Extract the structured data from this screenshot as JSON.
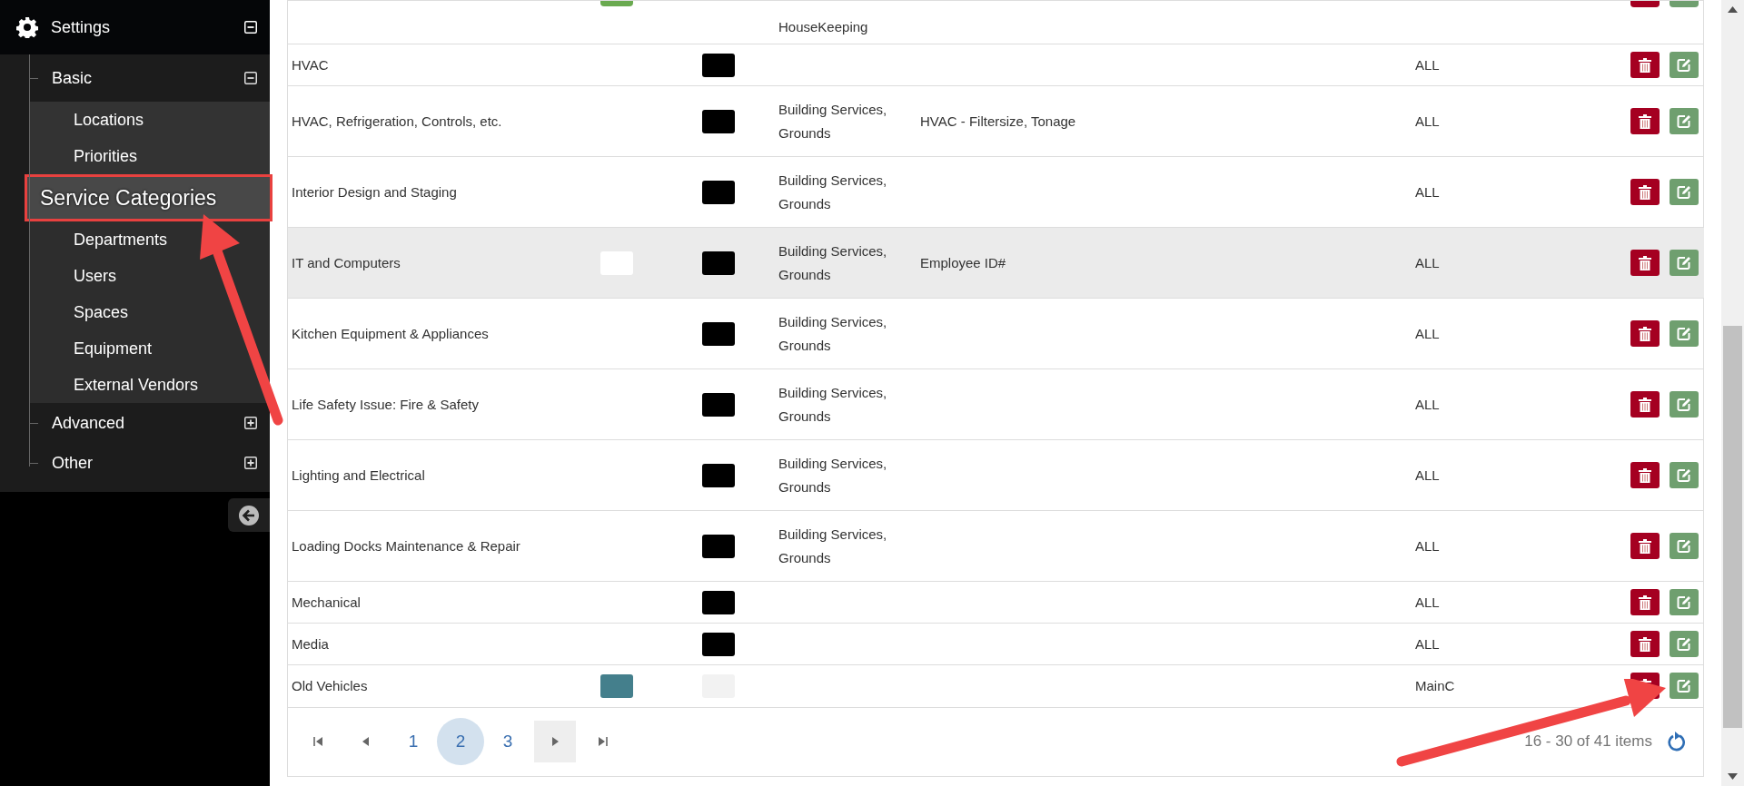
{
  "sidebar": {
    "title": "Settings",
    "expanded": true,
    "groups": [
      {
        "label": "Basic",
        "expanded": true,
        "children": [
          {
            "label": "Locations",
            "selected": false
          },
          {
            "label": "Priorities",
            "selected": false
          },
          {
            "label": "Service Categories",
            "selected": true
          },
          {
            "label": "Departments",
            "selected": false
          },
          {
            "label": "Users",
            "selected": false
          },
          {
            "label": "Spaces",
            "selected": false
          },
          {
            "label": "Equipment",
            "selected": false
          },
          {
            "label": "External Vendors",
            "selected": false
          }
        ]
      },
      {
        "label": "Advanced",
        "expanded": false
      },
      {
        "label": "Other",
        "expanded": false
      }
    ]
  },
  "table": {
    "rows": [
      {
        "kind": "clipped",
        "selected": false,
        "name": "",
        "swatch_1": {
          "color": "#6aaa50"
        },
        "departments": "HouseKeeping",
        "location": ""
      },
      {
        "kind": "full",
        "selected": false,
        "name": "HVAC",
        "swatch_2": {
          "color": "#000000"
        },
        "location": "ALL"
      },
      {
        "kind": "full",
        "selected": false,
        "name": "HVAC, Refrigeration, Controls, etc.",
        "swatch_2": {
          "color": "#000000"
        },
        "departments": "Building Services, Grounds",
        "fields": "HVAC - Filtersize, Tonage",
        "location": "ALL"
      },
      {
        "kind": "full",
        "selected": false,
        "name": "Interior Design and Staging",
        "swatch_2": {
          "color": "#000000"
        },
        "departments": "Building Services, Grounds",
        "location": "ALL"
      },
      {
        "kind": "full",
        "selected": true,
        "name": "IT and Computers",
        "swatch_1": {
          "color": "#ffffff"
        },
        "swatch_2": {
          "color": "#000000"
        },
        "departments": "Building Services, Grounds",
        "fields": "Employee ID#",
        "location": "ALL"
      },
      {
        "kind": "full",
        "selected": false,
        "name": "Kitchen Equipment & Appliances",
        "swatch_2": {
          "color": "#000000"
        },
        "departments": "Building Services, Grounds",
        "location": "ALL"
      },
      {
        "kind": "full",
        "selected": false,
        "name": "Life Safety Issue: Fire & Safety",
        "swatch_2": {
          "color": "#000000"
        },
        "departments": "Building Services, Grounds",
        "location": "ALL"
      },
      {
        "kind": "full",
        "selected": false,
        "name": "Lighting and Electrical",
        "swatch_2": {
          "color": "#000000"
        },
        "departments": "Building Services, Grounds",
        "location": "ALL"
      },
      {
        "kind": "full",
        "selected": false,
        "name": "Loading Docks Maintenance & Repair",
        "swatch_2": {
          "color": "#000000"
        },
        "departments": "Building Services, Grounds",
        "location": "ALL"
      },
      {
        "kind": "full",
        "selected": false,
        "name": "Mechanical",
        "swatch_2": {
          "color": "#000000"
        },
        "location": "ALL"
      },
      {
        "kind": "full",
        "selected": false,
        "name": "Media",
        "swatch_2": {
          "color": "#000000"
        },
        "location": "ALL"
      },
      {
        "kind": "full",
        "selected": false,
        "name": "Old Vehicles",
        "swatch_1": {
          "color": "#447f8c"
        },
        "swatch_2": {
          "color": "#f2f2f2"
        },
        "location": "MainC"
      }
    ]
  },
  "pager": {
    "buttons": [
      {
        "kind": "first",
        "highlighted": false
      },
      {
        "kind": "prev",
        "highlighted": false
      },
      {
        "kind": "page",
        "label": "1",
        "selected": false
      },
      {
        "kind": "page",
        "label": "2",
        "selected": true
      },
      {
        "kind": "page",
        "label": "3",
        "selected": false
      },
      {
        "kind": "next",
        "highlighted": true
      },
      {
        "kind": "last",
        "highlighted": false
      }
    ],
    "info": "16 - 30 of 41 items"
  }
}
